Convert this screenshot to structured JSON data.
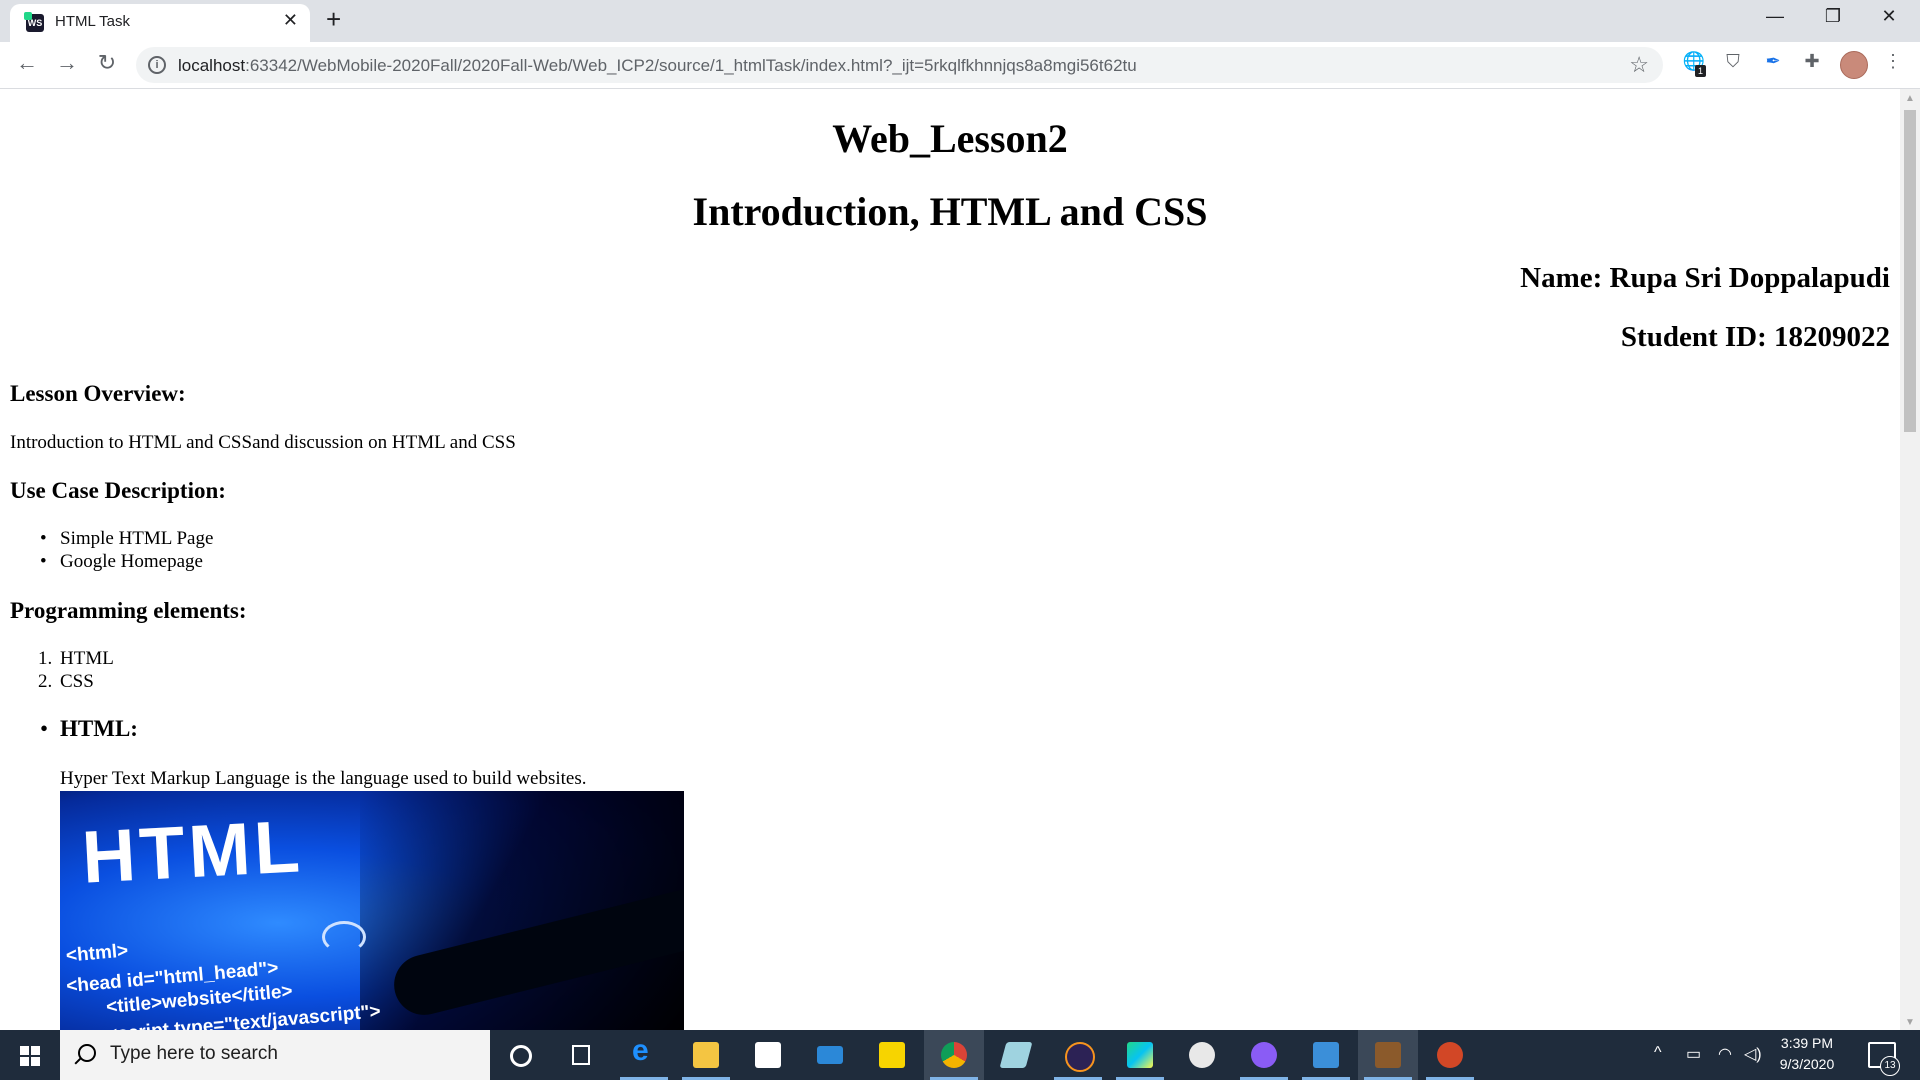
{
  "browser": {
    "tab_title": "HTML Task",
    "tab_close": "✕",
    "new_tab": "+",
    "minimize": "—",
    "maximize": "❐",
    "close": "✕",
    "url_host": "localhost",
    "url_rest": ":63342/WebMobile-2020Fall/2020Fall-Web/Web_ICP2/source/1_htmlTask/index.html?_ijt=5rkqlfkhnnjqs8a8mgi56t62tu",
    "extension_badge": "1",
    "icons": [
      "back-icon",
      "forward-icon",
      "reload-icon",
      "info-icon",
      "star-icon",
      "extension-icon",
      "shield-icon",
      "feather-icon",
      "puzzle-icon",
      "profile-avatar",
      "menu-icon"
    ]
  },
  "page": {
    "title": "Web_Lesson2",
    "subtitle": "Introduction, HTML and CSS",
    "name": "Name: Rupa Sri Doppalapudi",
    "student_id": "Student ID: 18209022",
    "overview_heading": "Lesson Overview:",
    "overview_text": "Introduction to HTML and CSSand discussion on HTML and CSS",
    "usecase_heading": "Use Case Description:",
    "usecase_items": [
      "Simple HTML Page",
      "Google Homepage"
    ],
    "programming_heading": "Programming elements:",
    "programming_items": [
      "HTML",
      "CSS"
    ],
    "html_heading": "HTML:",
    "html_text": "Hyper Text Markup Language is the language used to build websites.",
    "image_text": {
      "big": "HTML",
      "line1": "<html>",
      "line2": "<head id=\"html_head\">",
      "line3": "<title>website</title>",
      "line4": "<script type=\"text/javascript\">"
    }
  },
  "taskbar": {
    "search_placeholder": "Type here to search",
    "time": "3:39 PM",
    "date": "9/3/2020",
    "notification_count": "13",
    "apps": [
      "cortana",
      "task-view",
      "edge",
      "file-explorer",
      "store",
      "mail",
      "sticky-notes",
      "chrome",
      "notes",
      "eclipse",
      "webstorm",
      "paint",
      "github",
      "photos",
      "minecraft",
      "powerpoint"
    ]
  }
}
